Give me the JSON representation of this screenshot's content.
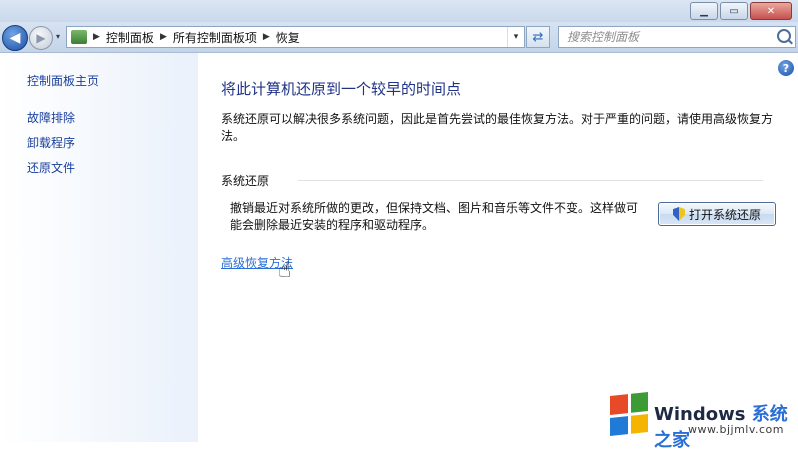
{
  "window": {
    "buttons": {
      "minimize": "▁",
      "maximize": "▭",
      "close": "✕"
    }
  },
  "nav": {
    "back": "◀",
    "forward": "▶",
    "history": "▾",
    "address": {
      "separator": "▶",
      "crumbs": [
        "控制面板",
        "所有控制面板项",
        "恢复"
      ],
      "dropdown": "▾"
    },
    "refresh": "⇄",
    "search": {
      "placeholder": "搜索控制面板",
      "value": ""
    }
  },
  "sidebar": {
    "home": "控制面板主页",
    "links": [
      "故障排除",
      "卸载程序",
      "还原文件"
    ]
  },
  "main": {
    "help": "?",
    "title": "将此计算机还原到一个较早的时间点",
    "description": "系统还原可以解决很多系统问题，因此是首先尝试的最佳恢复方法。对于严重的问题，请使用高级恢复方法。",
    "group": {
      "header": "系统还原",
      "text": "撤销最近对系统所做的更改，但保持文档、图片和音乐等文件不变。这样做可能会删除最近安装的程序和驱动程序。",
      "button": "打开系统还原"
    },
    "advanced_link": "高级恢复方法"
  },
  "watermark": {
    "title_en": "Windows",
    "title_cn": "系统之家",
    "url": "www.bjjmlv.com",
    "logo_colors": [
      "#e84a27",
      "#3d9b35",
      "#1f7ad8",
      "#f4b400"
    ]
  }
}
